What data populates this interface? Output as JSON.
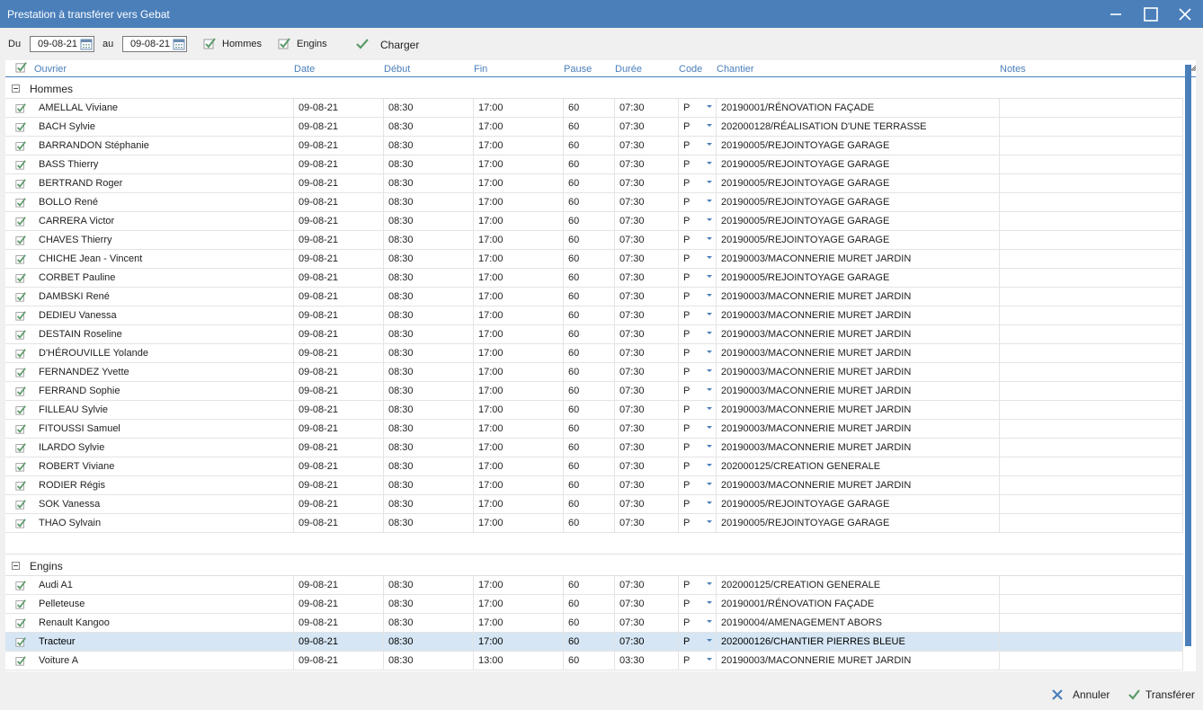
{
  "window": {
    "title": "Prestation à transférer vers Gebat"
  },
  "toolbar": {
    "du_label": "Du",
    "date_from": "09-08-21",
    "au_label": "au",
    "date_to": "09-08-21",
    "hommes_label": "Hommes",
    "engins_label": "Engins",
    "charger_label": "Charger"
  },
  "columns": {
    "ouvrier": "Ouvrier",
    "date": "Date",
    "debut": "Début",
    "fin": "Fin",
    "pause": "Pause",
    "duree": "Durée",
    "code": "Code",
    "chantier": "Chantier",
    "notes": "Notes"
  },
  "groups": [
    {
      "label": "Hommes",
      "rows": [
        {
          "name": "AMELLAL Viviane",
          "date": "09-08-21",
          "debut": "08:30",
          "fin": "17:00",
          "pause": "60",
          "duree": "07:30",
          "code": "P",
          "chantier": "20190001/RÉNOVATION FAÇADE",
          "notes": ""
        },
        {
          "name": "BACH Sylvie",
          "date": "09-08-21",
          "debut": "08:30",
          "fin": "17:00",
          "pause": "60",
          "duree": "07:30",
          "code": "P",
          "chantier": "202000128/RÉALISATION D'UNE TERRASSE",
          "notes": ""
        },
        {
          "name": "BARRANDON Stéphanie",
          "date": "09-08-21",
          "debut": "08:30",
          "fin": "17:00",
          "pause": "60",
          "duree": "07:30",
          "code": "P",
          "chantier": "20190005/REJOINTOYAGE GARAGE",
          "notes": ""
        },
        {
          "name": "BASS Thierry",
          "date": "09-08-21",
          "debut": "08:30",
          "fin": "17:00",
          "pause": "60",
          "duree": "07:30",
          "code": "P",
          "chantier": "20190005/REJOINTOYAGE GARAGE",
          "notes": ""
        },
        {
          "name": "BERTRAND Roger",
          "date": "09-08-21",
          "debut": "08:30",
          "fin": "17:00",
          "pause": "60",
          "duree": "07:30",
          "code": "P",
          "chantier": "20190005/REJOINTOYAGE GARAGE",
          "notes": ""
        },
        {
          "name": "BOLLO René",
          "date": "09-08-21",
          "debut": "08:30",
          "fin": "17:00",
          "pause": "60",
          "duree": "07:30",
          "code": "P",
          "chantier": "20190005/REJOINTOYAGE GARAGE",
          "notes": ""
        },
        {
          "name": "CARRERA Victor",
          "date": "09-08-21",
          "debut": "08:30",
          "fin": "17:00",
          "pause": "60",
          "duree": "07:30",
          "code": "P",
          "chantier": "20190005/REJOINTOYAGE GARAGE",
          "notes": ""
        },
        {
          "name": "CHAVES Thierry",
          "date": "09-08-21",
          "debut": "08:30",
          "fin": "17:00",
          "pause": "60",
          "duree": "07:30",
          "code": "P",
          "chantier": "20190005/REJOINTOYAGE GARAGE",
          "notes": ""
        },
        {
          "name": "CHICHE Jean - Vincent",
          "date": "09-08-21",
          "debut": "08:30",
          "fin": "17:00",
          "pause": "60",
          "duree": "07:30",
          "code": "P",
          "chantier": "20190003/MACONNERIE MURET JARDIN",
          "notes": ""
        },
        {
          "name": "CORBET Pauline",
          "date": "09-08-21",
          "debut": "08:30",
          "fin": "17:00",
          "pause": "60",
          "duree": "07:30",
          "code": "P",
          "chantier": "20190005/REJOINTOYAGE GARAGE",
          "notes": ""
        },
        {
          "name": "DAMBSKI René",
          "date": "09-08-21",
          "debut": "08:30",
          "fin": "17:00",
          "pause": "60",
          "duree": "07:30",
          "code": "P",
          "chantier": "20190003/MACONNERIE MURET JARDIN",
          "notes": ""
        },
        {
          "name": "DEDIEU Vanessa",
          "date": "09-08-21",
          "debut": "08:30",
          "fin": "17:00",
          "pause": "60",
          "duree": "07:30",
          "code": "P",
          "chantier": "20190003/MACONNERIE MURET JARDIN",
          "notes": ""
        },
        {
          "name": "DESTAIN Roseline",
          "date": "09-08-21",
          "debut": "08:30",
          "fin": "17:00",
          "pause": "60",
          "duree": "07:30",
          "code": "P",
          "chantier": "20190003/MACONNERIE MURET JARDIN",
          "notes": ""
        },
        {
          "name": "D'HÉROUVILLE Yolande",
          "date": "09-08-21",
          "debut": "08:30",
          "fin": "17:00",
          "pause": "60",
          "duree": "07:30",
          "code": "P",
          "chantier": "20190003/MACONNERIE MURET JARDIN",
          "notes": ""
        },
        {
          "name": "FERNANDEZ Yvette",
          "date": "09-08-21",
          "debut": "08:30",
          "fin": "17:00",
          "pause": "60",
          "duree": "07:30",
          "code": "P",
          "chantier": "20190003/MACONNERIE MURET JARDIN",
          "notes": ""
        },
        {
          "name": "FERRAND Sophie",
          "date": "09-08-21",
          "debut": "08:30",
          "fin": "17:00",
          "pause": "60",
          "duree": "07:30",
          "code": "P",
          "chantier": "20190003/MACONNERIE MURET JARDIN",
          "notes": ""
        },
        {
          "name": "FILLEAU Sylvie",
          "date": "09-08-21",
          "debut": "08:30",
          "fin": "17:00",
          "pause": "60",
          "duree": "07:30",
          "code": "P",
          "chantier": "20190003/MACONNERIE MURET JARDIN",
          "notes": ""
        },
        {
          "name": "FITOUSSI Samuel",
          "date": "09-08-21",
          "debut": "08:30",
          "fin": "17:00",
          "pause": "60",
          "duree": "07:30",
          "code": "P",
          "chantier": "20190003/MACONNERIE MURET JARDIN",
          "notes": ""
        },
        {
          "name": "ILARDO Sylvie",
          "date": "09-08-21",
          "debut": "08:30",
          "fin": "17:00",
          "pause": "60",
          "duree": "07:30",
          "code": "P",
          "chantier": "20190003/MACONNERIE MURET JARDIN",
          "notes": ""
        },
        {
          "name": "ROBERT Viviane",
          "date": "09-08-21",
          "debut": "08:30",
          "fin": "17:00",
          "pause": "60",
          "duree": "07:30",
          "code": "P",
          "chantier": "202000125/CREATION GENERALE",
          "notes": ""
        },
        {
          "name": "RODIER Régis",
          "date": "09-08-21",
          "debut": "08:30",
          "fin": "17:00",
          "pause": "60",
          "duree": "07:30",
          "code": "P",
          "chantier": "20190003/MACONNERIE MURET JARDIN",
          "notes": ""
        },
        {
          "name": "SOK Vanessa",
          "date": "09-08-21",
          "debut": "08:30",
          "fin": "17:00",
          "pause": "60",
          "duree": "07:30",
          "code": "P",
          "chantier": "20190005/REJOINTOYAGE GARAGE",
          "notes": ""
        },
        {
          "name": "THAO Sylvain",
          "date": "09-08-21",
          "debut": "08:30",
          "fin": "17:00",
          "pause": "60",
          "duree": "07:30",
          "code": "P",
          "chantier": "20190005/REJOINTOYAGE GARAGE",
          "notes": ""
        }
      ]
    },
    {
      "label": "Engins",
      "rows": [
        {
          "name": "Audi A1",
          "date": "09-08-21",
          "debut": "08:30",
          "fin": "17:00",
          "pause": "60",
          "duree": "07:30",
          "code": "P",
          "chantier": "202000125/CREATION GENERALE",
          "notes": ""
        },
        {
          "name": "Pelleteuse",
          "date": "09-08-21",
          "debut": "08:30",
          "fin": "17:00",
          "pause": "60",
          "duree": "07:30",
          "code": "P",
          "chantier": "20190001/RÉNOVATION FAÇADE",
          "notes": ""
        },
        {
          "name": "Renault Kangoo",
          "date": "09-08-21",
          "debut": "08:30",
          "fin": "17:00",
          "pause": "60",
          "duree": "07:30",
          "code": "P",
          "chantier": "20190004/AMENAGEMENT ABORS",
          "notes": ""
        },
        {
          "name": "Tracteur",
          "date": "09-08-21",
          "debut": "08:30",
          "fin": "17:00",
          "pause": "60",
          "duree": "07:30",
          "code": "P",
          "chantier": "202000126/CHANTIER PIERRES BLEUE",
          "notes": "",
          "selected": true
        },
        {
          "name": "Voiture A",
          "date": "09-08-21",
          "debut": "08:30",
          "fin": "13:00",
          "pause": "60",
          "duree": "03:30",
          "code": "P",
          "chantier": "20190003/MACONNERIE MURET JARDIN",
          "notes": ""
        }
      ]
    }
  ],
  "footer": {
    "cancel_label": "Annuler",
    "transfer_label": "Transférer"
  },
  "colors": {
    "accent": "#4a7fba",
    "selected_row": "#d6e6f4",
    "check_green": "#5a9a6a"
  }
}
